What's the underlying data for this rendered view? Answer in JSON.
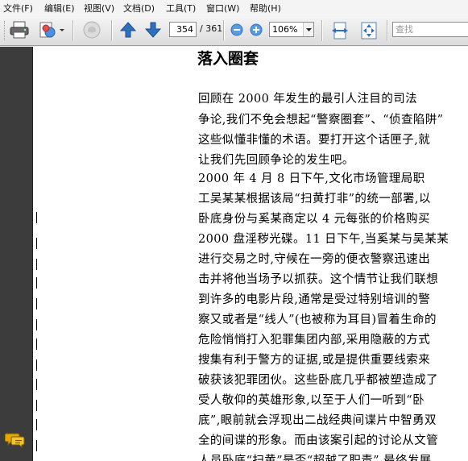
{
  "menu": [
    "文件(F)",
    "编辑(E)",
    "视图(V)",
    "文档(D)",
    "工具(T)",
    "窗口(W)",
    "帮助(H)"
  ],
  "toolbar": {
    "current_page": "354",
    "total_pages": "/ 361",
    "zoom": "106%",
    "search_placeholder": "查找"
  },
  "document": {
    "heading": "落入圈套",
    "lines": [
      "    回顾在 2000 年发生的最引人注目的司法",
      "争论,我们不免会想起“警察圈套”、“侦查陷阱”",
      "这些似懂非懂的术语。要打开这个话匣子,就",
      "让我们先回顾争论的发生吧。",
      "    2000 年 4 月 8 日下午,文化市场管理局职",
      "工吴某某根据该局“扫黄打非”的统一部署,以",
      "卧底身份与奚某商定以 4 元每张的价格购买",
      "2000 盘淫秽光碟。11 日下午,当奚某与吴某某",
      "进行交易之时,守候在一旁的便衣警察迅速出",
      "击并将他当场予以抓获。这个情节让我们联想",
      "到许多的电影片段,通常是受过特别培训的警",
      "察又或者是“线人”(也被称为耳目)冒着生命的",
      "危险悄悄打入犯罪集团内部,采用隐蔽的方式",
      "搜集有利于警方的证据,或是提供重要线索来",
      "破获该犯罪团伙。这些卧底几乎都被塑造成了",
      "受人敬仰的英雄形象,以至于人们一听到“卧",
      "底”,眼前就会浮现出二战经典间谍片中智勇双",
      "全的间谍的形象。而由该案引起的讨论从文管",
      "人员卧底“扫黄”是否“超越了职责”,最终发展"
    ]
  },
  "colors": {
    "left_pane": "#3c3c3c",
    "arrow_blue": "#2f6fc0",
    "comment_icon": "#e0a800"
  }
}
